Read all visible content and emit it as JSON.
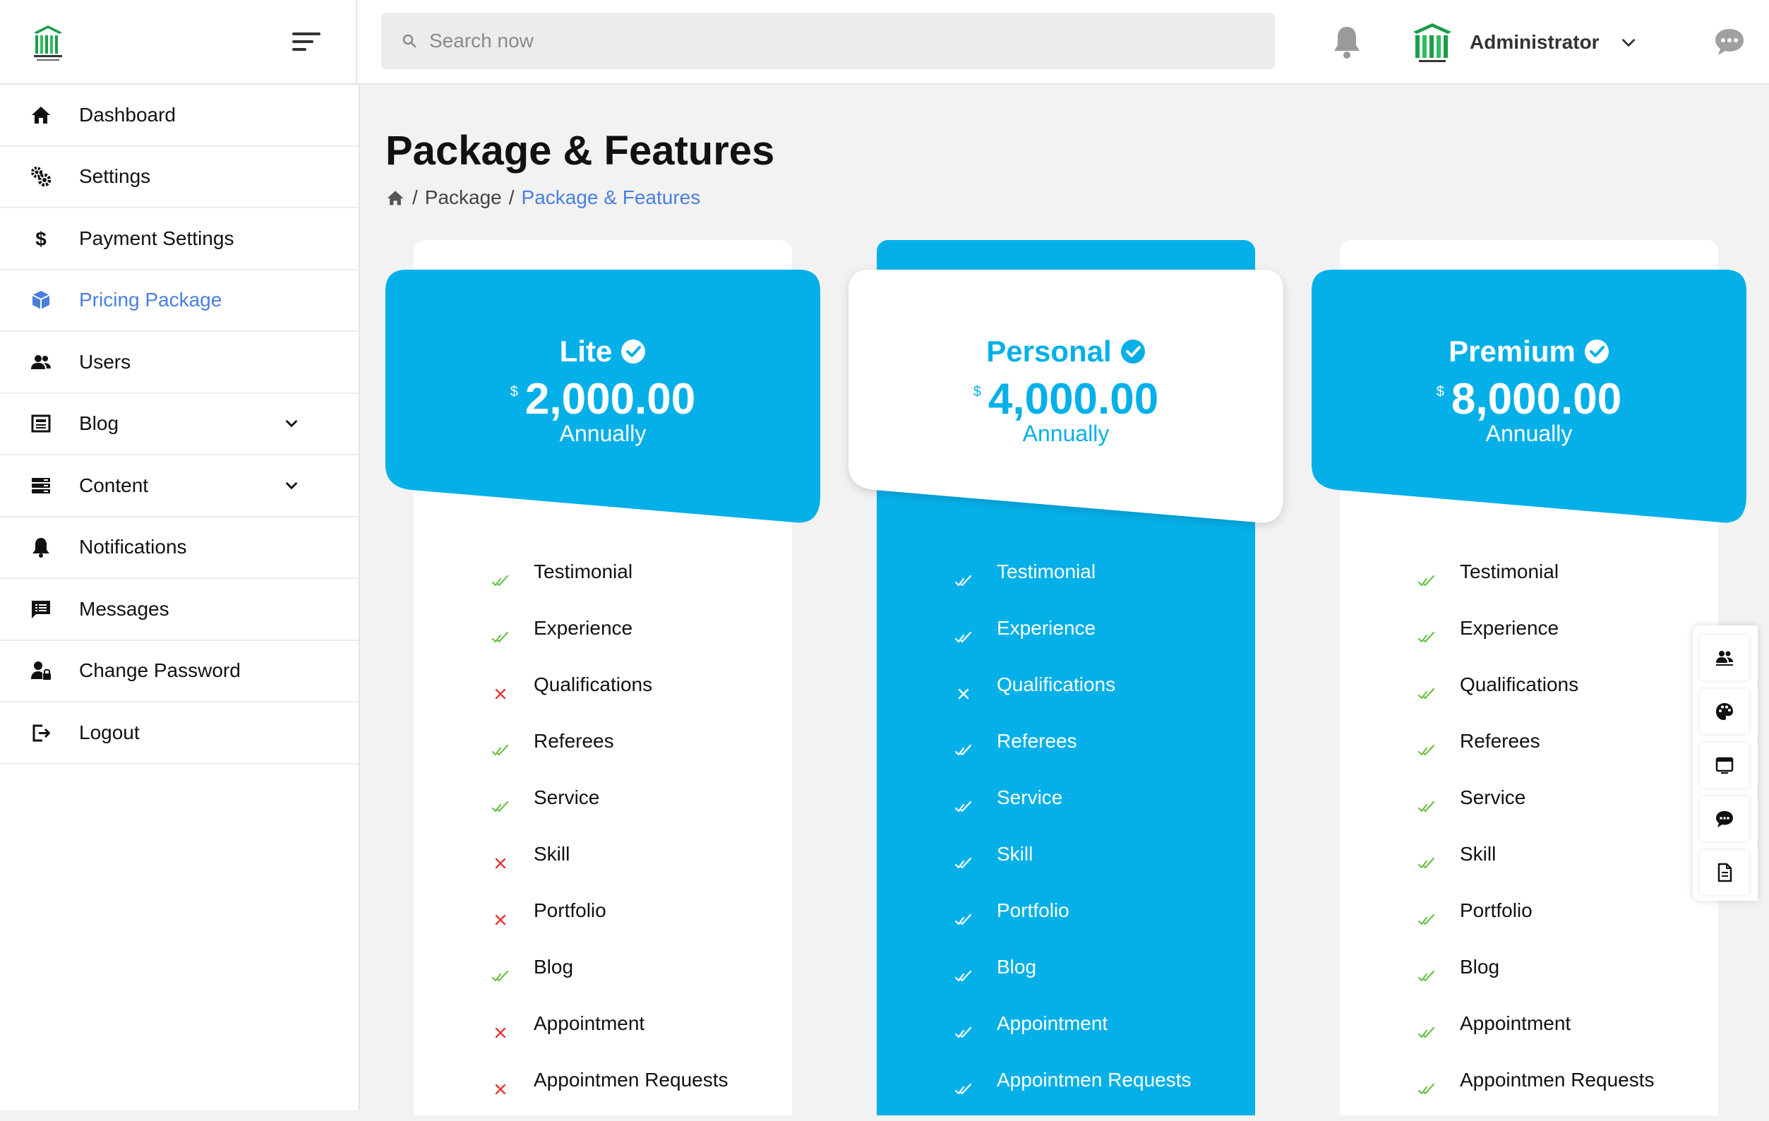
{
  "header": {
    "search_placeholder": "Search now",
    "user_name": "Administrator"
  },
  "sidebar": {
    "items": [
      {
        "label": "Dashboard",
        "icon": "home-icon"
      },
      {
        "label": "Settings",
        "icon": "gears-icon"
      },
      {
        "label": "Payment Settings",
        "icon": "dollar-icon"
      },
      {
        "label": "Pricing Package",
        "icon": "cube-icon",
        "active": true
      },
      {
        "label": "Users",
        "icon": "users-icon"
      },
      {
        "label": "Blog",
        "icon": "newspaper-icon",
        "has_submenu": true
      },
      {
        "label": "Content",
        "icon": "server-icon",
        "has_submenu": true
      },
      {
        "label": "Notifications",
        "icon": "bell-icon"
      },
      {
        "label": "Messages",
        "icon": "message-list-icon"
      },
      {
        "label": "Change Password",
        "icon": "user-lock-icon"
      },
      {
        "label": "Logout",
        "icon": "logout-icon"
      }
    ]
  },
  "main": {
    "title": "Package & Features",
    "breadcrumb": {
      "parent": "Package",
      "separator": "/",
      "current": "Package & Features"
    }
  },
  "packages": [
    {
      "name": "Lite",
      "currency": "$",
      "price": "2,000.00",
      "period": "Annually",
      "features": [
        {
          "label": "Testimonial",
          "included": true
        },
        {
          "label": "Experience",
          "included": true
        },
        {
          "label": "Qualifications",
          "included": false
        },
        {
          "label": "Referees",
          "included": true
        },
        {
          "label": "Service",
          "included": true
        },
        {
          "label": "Skill",
          "included": false
        },
        {
          "label": "Portfolio",
          "included": false
        },
        {
          "label": "Blog",
          "included": true
        },
        {
          "label": "Appointment",
          "included": false
        },
        {
          "label": "Appointmen Requests",
          "included": false
        }
      ]
    },
    {
      "name": "Personal",
      "currency": "$",
      "price": "4,000.00",
      "period": "Annually",
      "features": [
        {
          "label": "Testimonial",
          "included": true
        },
        {
          "label": "Experience",
          "included": true
        },
        {
          "label": "Qualifications",
          "included": false
        },
        {
          "label": "Referees",
          "included": true
        },
        {
          "label": "Service",
          "included": true
        },
        {
          "label": "Skill",
          "included": true
        },
        {
          "label": "Portfolio",
          "included": true
        },
        {
          "label": "Blog",
          "included": true
        },
        {
          "label": "Appointment",
          "included": true
        },
        {
          "label": "Appointmen Requests",
          "included": true
        }
      ]
    },
    {
      "name": "Premium",
      "currency": "$",
      "price": "8,000.00",
      "period": "Annually",
      "features": [
        {
          "label": "Testimonial",
          "included": true
        },
        {
          "label": "Experience",
          "included": true
        },
        {
          "label": "Qualifications",
          "included": true
        },
        {
          "label": "Referees",
          "included": true
        },
        {
          "label": "Service",
          "included": true
        },
        {
          "label": "Skill",
          "included": true
        },
        {
          "label": "Portfolio",
          "included": true
        },
        {
          "label": "Blog",
          "included": true
        },
        {
          "label": "Appointment",
          "included": true
        },
        {
          "label": "Appointmen Requests",
          "included": true
        }
      ]
    }
  ],
  "toolbox": [
    "users-icon",
    "palette-icon",
    "window-icon",
    "chat-icon",
    "document-icon"
  ],
  "colors": {
    "accent_blue": "#05b0e8",
    "link_blue": "#4a7fe0",
    "check_green": "#6cc04a",
    "cross_red": "#e53935"
  }
}
